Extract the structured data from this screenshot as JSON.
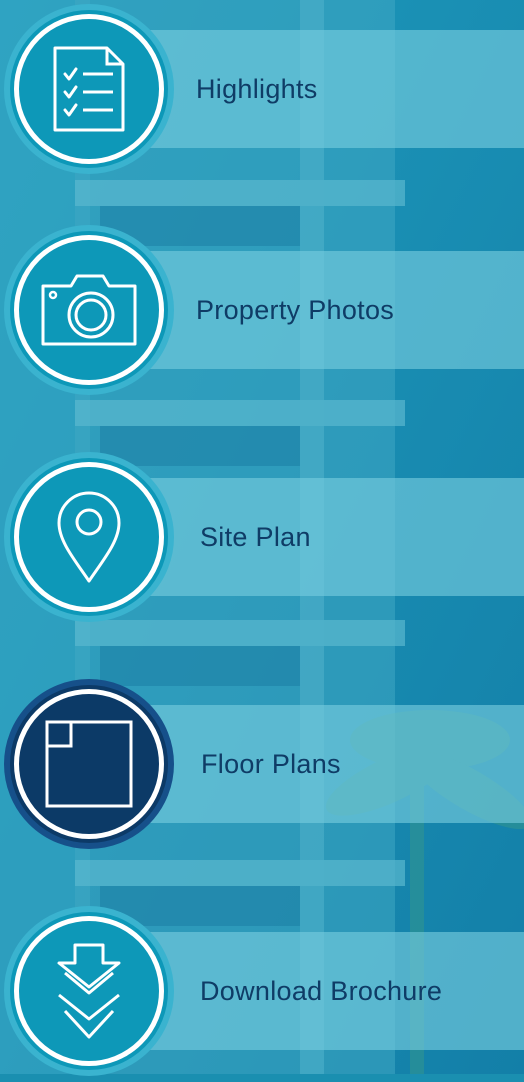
{
  "nav": {
    "items": [
      {
        "label": "Highlights",
        "icon": "checklist-icon",
        "active": false
      },
      {
        "label": "Property Photos",
        "icon": "camera-icon",
        "active": false
      },
      {
        "label": "Site Plan",
        "icon": "map-pin-icon",
        "active": false
      },
      {
        "label": "Floor Plans",
        "icon": "floor-plan-icon",
        "active": true
      },
      {
        "label": "Download Brochure",
        "icon": "download-arrows-icon",
        "active": false
      }
    ]
  },
  "colors": {
    "accent": "#0d98b8",
    "active": "#0c3a67",
    "label": "#0f3c66",
    "band": "#78cdde"
  }
}
